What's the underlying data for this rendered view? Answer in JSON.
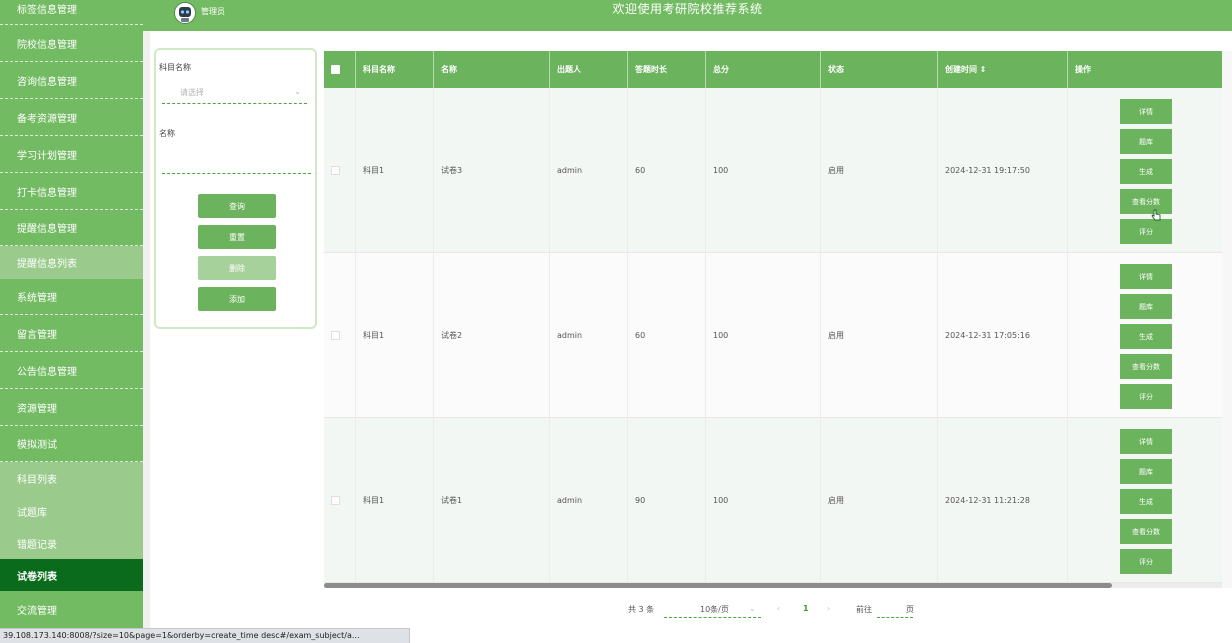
{
  "header": {
    "title": "欢迎使用考研院校推荐系统",
    "role": "管理员"
  },
  "sidebar": {
    "items": [
      {
        "label": "标签信息管理"
      },
      {
        "label": "院校信息管理"
      },
      {
        "label": "咨询信息管理"
      },
      {
        "label": "备考资源管理"
      },
      {
        "label": "学习计划管理"
      },
      {
        "label": "打卡信息管理"
      },
      {
        "label": "提醒信息管理"
      },
      {
        "label": "提醒信息列表"
      },
      {
        "label": "系统管理"
      },
      {
        "label": "留言管理"
      },
      {
        "label": "公告信息管理"
      },
      {
        "label": "资源管理"
      },
      {
        "label": "模拟测试"
      },
      {
        "label": "科目列表"
      },
      {
        "label": "试题库"
      },
      {
        "label": "错题记录"
      },
      {
        "label": "试卷列表"
      },
      {
        "label": "交流管理"
      }
    ]
  },
  "search": {
    "subject_label": "科目名称",
    "subject_placeholder": "请选择",
    "name_label": "名称",
    "query_btn": "查询",
    "reset_btn": "重置",
    "delete_btn": "删除",
    "add_btn": "添加"
  },
  "table": {
    "columns": [
      "科目名称",
      "名称",
      "出题人",
      "答题时长",
      "总分",
      "状态",
      "创建时间 ⇕",
      "操作"
    ],
    "actions": [
      "详情",
      "题库",
      "生成",
      "查看分数",
      "评分"
    ],
    "rows": [
      {
        "subject": "科目1",
        "name": "试卷3",
        "author": "admin",
        "duration": "60",
        "total": "100",
        "status": "启用",
        "created": "2024-12-31 19:17:50"
      },
      {
        "subject": "科目1",
        "name": "试卷2",
        "author": "admin",
        "duration": "60",
        "total": "100",
        "status": "启用",
        "created": "2024-12-31 17:05:16"
      },
      {
        "subject": "科目1",
        "name": "试卷1",
        "author": "admin",
        "duration": "90",
        "total": "100",
        "status": "启用",
        "created": "2024-12-31 11:21:28"
      }
    ]
  },
  "pagination": {
    "total": "共 3 条",
    "size": "10条/页",
    "page": "1",
    "goto": "前往",
    "page_suffix": "页",
    "prev": "‹",
    "next": "›",
    "chev": "⌄"
  },
  "statusbar": {
    "url": "39.108.173.140:8008/?size=10&page=1&orderby=create_time desc#/exam_subject/a..."
  },
  "colors": {
    "primary": "#73bb63",
    "active": "#0b6b1c",
    "button": "#6cb35e"
  }
}
